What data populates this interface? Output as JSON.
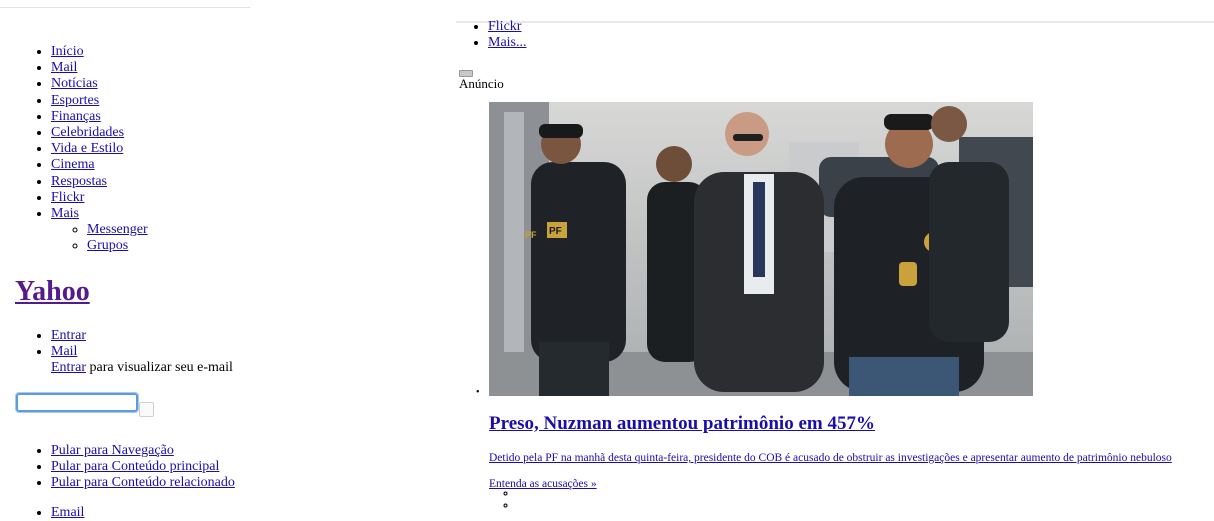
{
  "left_nav": {
    "items": [
      {
        "label": "Início"
      },
      {
        "label": "Mail"
      },
      {
        "label": "Notícias"
      },
      {
        "label": "Esportes"
      },
      {
        "label": "Finanças"
      },
      {
        "label": "Celebridades"
      },
      {
        "label": "Vida e Estilo"
      },
      {
        "label": "Cinema"
      },
      {
        "label": "Respostas"
      },
      {
        "label": "Flickr"
      },
      {
        "label": "Mais"
      }
    ],
    "submenu": [
      {
        "label": "Messenger"
      },
      {
        "label": "Grupos"
      }
    ]
  },
  "brand": {
    "label": "Yahoo"
  },
  "account": {
    "signin": "Entrar",
    "mail": "Mail",
    "mail_signin": "Entrar",
    "mail_hint": " para visualizar seu e-mail"
  },
  "search": {
    "placeholder": "",
    "value": ""
  },
  "skip_links": [
    {
      "label": "Pular para Navegação"
    },
    {
      "label": "Pular para Conteúdo principal"
    },
    {
      "label": "Pular para Conteúdo relacionado"
    }
  ],
  "extra_links": [
    {
      "label": "Email"
    }
  ],
  "top_links": [
    {
      "label": "Flickr"
    },
    {
      "label": "Mais..."
    }
  ],
  "ad": {
    "label": "Anúncio"
  },
  "story": {
    "headline": "Preso, Nuzman aumentou patrimônio em 457%",
    "summary": "Detido pela PF na manhã desta quinta-feira, presidente do COB é acusado de obstruir as investigações e apresentar aumento de patrimônio nebuloso",
    "more": "Entenda as acusações »",
    "photo_badges": [
      "PF",
      "PF"
    ]
  }
}
